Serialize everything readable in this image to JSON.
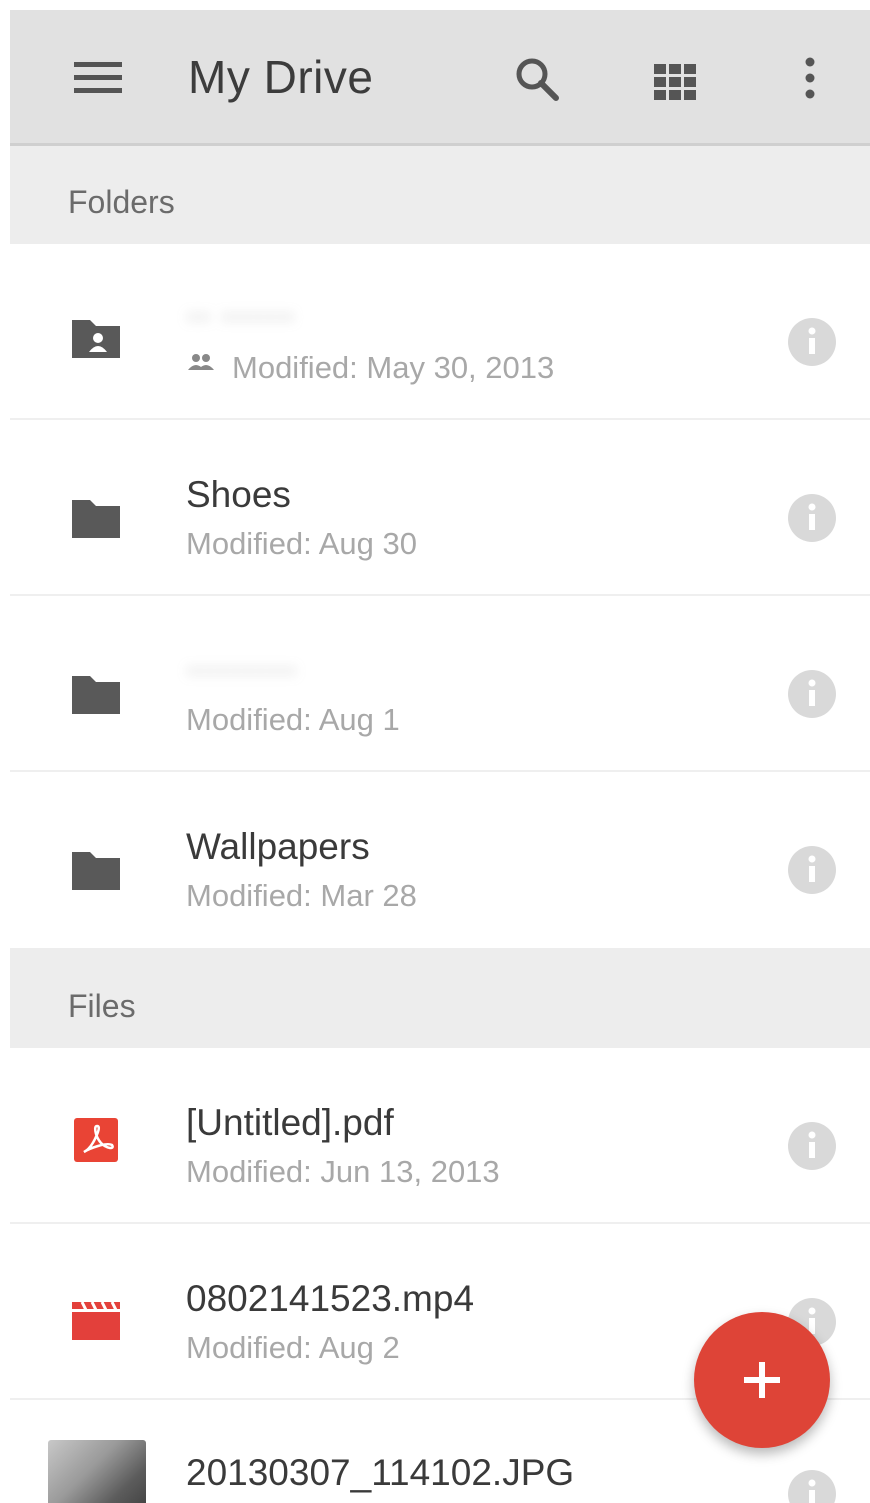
{
  "app_bar": {
    "title": "My Drive",
    "menu_icon": "hamburger-menu-icon",
    "search_icon": "search-icon",
    "view_icon": "grid-view-icon",
    "more_icon": "more-vert-icon",
    "background": "#e1e1e1"
  },
  "sections": {
    "folders_label": "Folders",
    "files_label": "Files"
  },
  "folders": [
    {
      "name": "·· ······",
      "meta": "Modified: May 30, 2013",
      "icon": "shared-folder-icon",
      "shared": true,
      "name_blurred": true
    },
    {
      "name": "Shoes",
      "meta": "Modified: Aug 30",
      "icon": "folder-icon",
      "shared": false,
      "name_blurred": false
    },
    {
      "name": "·········",
      "meta": "Modified: Aug 1",
      "icon": "folder-icon",
      "shared": false,
      "name_blurred": true
    },
    {
      "name": "Wallpapers",
      "meta": "Modified: Mar 28",
      "icon": "folder-icon",
      "shared": false,
      "name_blurred": false
    }
  ],
  "files": [
    {
      "name": "[Untitled].pdf",
      "meta": "Modified: Jun 13, 2013",
      "icon": "pdf-icon"
    },
    {
      "name": "0802141523.mp4",
      "meta": "Modified: Aug 2",
      "icon": "video-icon"
    },
    {
      "name": "20130307_114102.JPG",
      "meta": "",
      "icon": "image-thumbnail"
    }
  ],
  "fab": {
    "label": "+",
    "icon": "add-icon",
    "color": "#de4437"
  },
  "colors": {
    "pdf_red": "#e94435",
    "video_red": "#e3403b",
    "folder_gray": "#595959",
    "info_gray": "#d9d9d9"
  }
}
